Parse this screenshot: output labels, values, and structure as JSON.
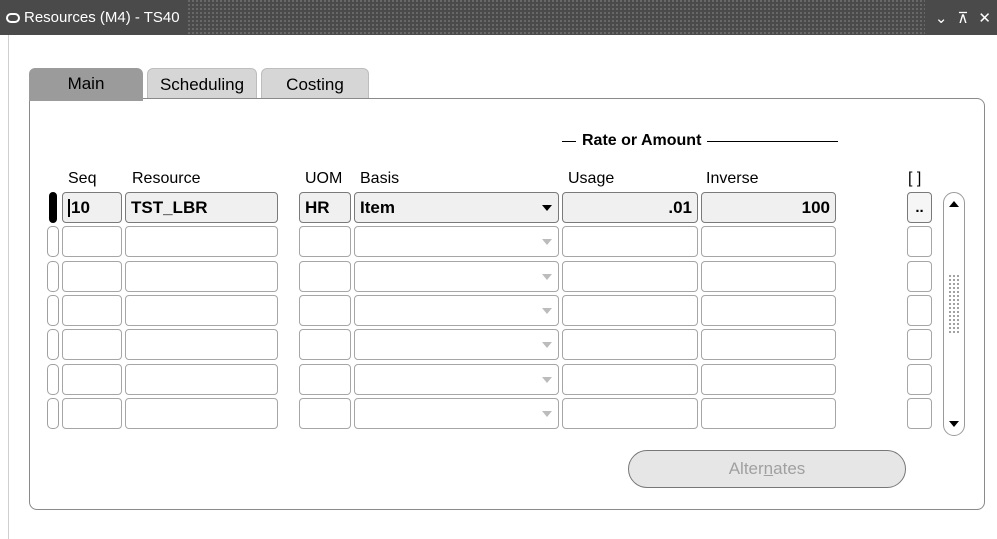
{
  "window": {
    "title": "Resources (M4) - TS40",
    "minimize_glyph": "⌄",
    "maximize_glyph": "⊼",
    "close_glyph": "✕"
  },
  "tabs": [
    {
      "label": "Main",
      "active": true
    },
    {
      "label": "Scheduling",
      "active": false
    },
    {
      "label": "Costing",
      "active": false
    }
  ],
  "group_label": "Rate or Amount",
  "columns": {
    "seq": "Seq",
    "resource": "Resource",
    "uom": "UOM",
    "basis": "Basis",
    "usage": "Usage",
    "inverse": "Inverse",
    "more": "[ ]"
  },
  "rows": [
    {
      "seq": "10",
      "resource": "TST_LBR",
      "uom": "HR",
      "basis": "Item",
      "usage": ".01",
      "inverse": "100",
      "more": ".."
    },
    {
      "seq": "",
      "resource": "",
      "uom": "",
      "basis": "",
      "usage": "",
      "inverse": "",
      "more": ""
    },
    {
      "seq": "",
      "resource": "",
      "uom": "",
      "basis": "",
      "usage": "",
      "inverse": "",
      "more": ""
    },
    {
      "seq": "",
      "resource": "",
      "uom": "",
      "basis": "",
      "usage": "",
      "inverse": "",
      "more": ""
    },
    {
      "seq": "",
      "resource": "",
      "uom": "",
      "basis": "",
      "usage": "",
      "inverse": "",
      "more": ""
    },
    {
      "seq": "",
      "resource": "",
      "uom": "",
      "basis": "",
      "usage": "",
      "inverse": "",
      "more": ""
    },
    {
      "seq": "",
      "resource": "",
      "uom": "",
      "basis": "",
      "usage": "",
      "inverse": "",
      "more": ""
    }
  ],
  "alternates_button": {
    "pre": "Alter",
    "underlined": "n",
    "post": "ates",
    "enabled": false
  }
}
